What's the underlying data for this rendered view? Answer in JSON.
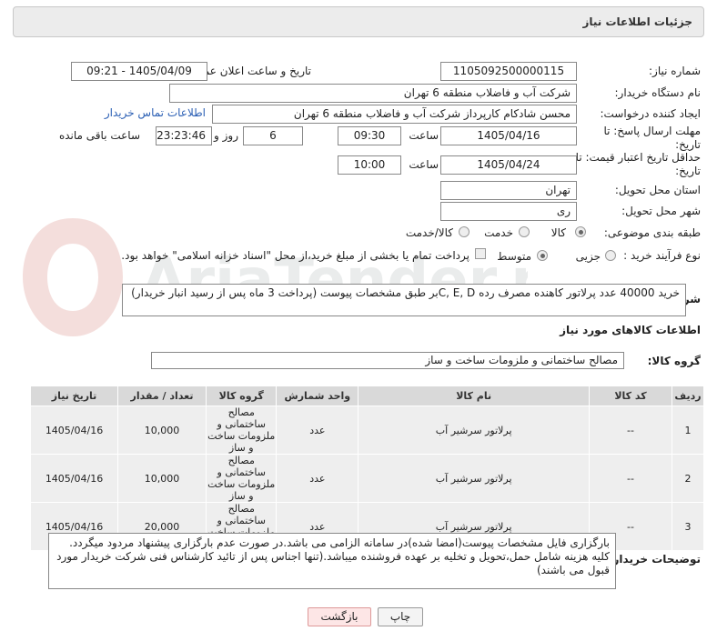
{
  "header": {
    "title": "جزئیات اطلاعات نیاز"
  },
  "fields": {
    "need_number_label": "شماره نیاز:",
    "need_number": "1105092500000115",
    "announce_label": "تاریخ و ساعت اعلان عمومی:",
    "announce_value": "1405/04/09 - 09:21",
    "buyer_org_label": "نام دستگاه خریدار:",
    "buyer_org": "شرکت آب و فاضلاب منطقه 6 تهران",
    "requester_label": "ایجاد کننده درخواست:",
    "requester": "محسن شادکام کارپرداز شرکت آب و فاضلاب منطقه 6 تهران",
    "contact_link": "اطلاعات تماس خریدار",
    "deadline_label": "مهلت ارسال پاسخ: تا تاریخ:",
    "deadline_date": "1405/04/16",
    "time_label": "ساعت",
    "deadline_time": "09:30",
    "days_value": "6",
    "days_label": "روز و",
    "remaining_time": "23:23:46",
    "remaining_label": "ساعت باقی مانده",
    "validity_label": "حداقل تاریخ اعتبار قیمت: تا تاریخ:",
    "validity_date": "1405/04/24",
    "validity_time": "10:00",
    "province_label": "استان محل تحویل:",
    "province": "تهران",
    "city_label": "شهر محل تحویل:",
    "city": "ری",
    "category_label": "طبقه بندی موضوعی:",
    "cat_goods": "کالا",
    "cat_service": "خدمت",
    "cat_goods_service": "کالا/خدمت",
    "process_label": "نوع فرآیند خرید :",
    "proc_partial": "جزیی",
    "proc_medium": "متوسط",
    "payment_note": "پرداخت تمام یا بخشی از مبلغ خرید،از محل \"اسناد خزانه اسلامی\" خواهد بود."
  },
  "general_desc": {
    "label": "شرح کلی نیاز:",
    "text": "خرید 40000 عدد پرلاتور کاهنده مصرف رده C, E, Dبر طبق مشخصات پیوست (پرداخت 3 ماه پس از رسید انبار خریدار)"
  },
  "goods_section": {
    "title": "اطلاعات کالاهای مورد نیاز",
    "group_label": "گروه کالا:",
    "group_value": "مصالح ساختمانی و ملزومات ساخت و ساز"
  },
  "table": {
    "headers": {
      "row": "ردیف",
      "code": "کد کالا",
      "name": "نام کالا",
      "unit": "واحد شمارش",
      "group": "گروه کالا",
      "qty": "تعداد / مقدار",
      "date": "تاریخ نیاز"
    },
    "rows": [
      {
        "row": "1",
        "code": "--",
        "name": "پرلاتور سرشیر آب",
        "unit": "عدد",
        "group": "مصالح ساختمانی و ملزومات ساخت و ساز",
        "qty": "10,000",
        "date": "1405/04/16"
      },
      {
        "row": "2",
        "code": "--",
        "name": "پرلاتور سرشیر آب",
        "unit": "عدد",
        "group": "مصالح ساختمانی و ملزومات ساخت و ساز",
        "qty": "10,000",
        "date": "1405/04/16"
      },
      {
        "row": "3",
        "code": "--",
        "name": "پرلاتور سرشیر آب",
        "unit": "عدد",
        "group": "مصالح ساختمانی و ملزومات ساخت و ساز",
        "qty": "20,000",
        "date": "1405/04/16"
      }
    ]
  },
  "buyer_notes": {
    "label": "توضیحات خریدار:",
    "text": "بارگزاری فایل مشخصات پیوست(امضا شده)در سامانه الزامی می باشد.در صورت عدم بارگزاری پیشنهاد مردود میگردد. کلیه هزینه شامل حمل،تحویل و تخلیه بر عهده فروشنده میباشد.(تنها اجناس پس از تائید کارشناس فنی شرکت خریدار مورد قبول می باشند)"
  },
  "buttons": {
    "print": "چاپ",
    "back": "بازگشت"
  },
  "watermark": {
    "text": "AriaTender.net"
  }
}
